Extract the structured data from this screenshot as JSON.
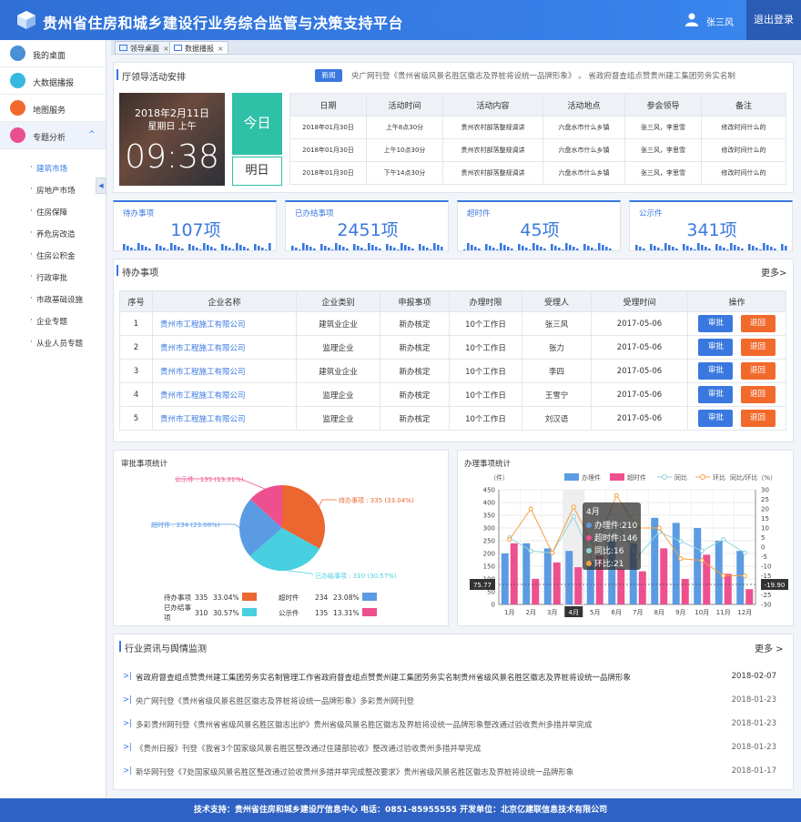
{
  "app": {
    "title": "贵州省住房和城乡建设行业务综合监管与决策支持平台",
    "user": "张三风",
    "logout": "退出登录"
  },
  "sidebar": {
    "items": [
      {
        "label": "我的桌面",
        "color": "#4a90d9"
      },
      {
        "label": "大数据播报",
        "color": "#36b8e0"
      },
      {
        "label": "地图服务",
        "color": "#f2692c"
      },
      {
        "label": "专题分析",
        "color": "#e84f8c"
      }
    ],
    "sub": [
      "建筑市场",
      "房地产市场",
      "住房保障",
      "养危房改造",
      "住房公积金",
      "行政审批",
      "市政基础设施",
      "企业专题",
      "从业人员专题"
    ],
    "arrow": "^",
    "dot": "·"
  },
  "tabs": [
    "领导桌面",
    "数据播报"
  ],
  "activities": {
    "title": "厅领导活动安排",
    "badge": "新闻",
    "marquee": "央广网刊登《贵州省级风景名胜区徽志及界桩将设统一品牌形象》  。  省政府督查组点赞贵州建工集团劳务实名制",
    "date": "2018年2月11日",
    "week": "星期日 上午",
    "time": "09:38",
    "today": "今日",
    "tomorrow": "明日",
    "headers": [
      "日期",
      "活动时间",
      "活动内容",
      "活动地点",
      "参会领导",
      "备注"
    ],
    "rows": [
      [
        "2018年01月30日",
        "上午8点30分",
        "贵州农村部落整规调讲",
        "六盘水市什么乡镇",
        "张三风，李思雪",
        "修改时间什么的"
      ],
      [
        "2018年01月30日",
        "上午10点30分",
        "贵州农村部落整规调讲",
        "六盘水市什么乡镇",
        "张三风，李思雪",
        "修改时间什么的"
      ],
      [
        "2018年01月30日",
        "下午14点30分",
        "贵州农村部落整规调讲",
        "六盘水市什么乡镇",
        "张三风，李思雪",
        "修改时间什么的"
      ]
    ]
  },
  "stats": [
    {
      "label": "待办事项",
      "value": "107项"
    },
    {
      "label": "已办结事项",
      "value": "2451项"
    },
    {
      "label": "超时件",
      "value": "45项"
    },
    {
      "label": "公示件",
      "value": "341项"
    }
  ],
  "todo": {
    "title": "待办事项",
    "more": "更多>",
    "headers": [
      "序号",
      "企业名称",
      "企业类别",
      "申报事项",
      "办理时限",
      "受理人",
      "受理时间",
      "操作"
    ],
    "rows": [
      [
        "1",
        "贵州市工程施工有限公司",
        "建筑业企业",
        "新办核定",
        "10个工作日",
        "张三风",
        "2017-05-06"
      ],
      [
        "2",
        "贵州市工程施工有限公司",
        "监理企业",
        "新办核定",
        "10个工作日",
        "张力",
        "2017-05-06"
      ],
      [
        "3",
        "贵州市工程施工有限公司",
        "建筑业企业",
        "新办核定",
        "10个工作日",
        "李四",
        "2017-05-06"
      ],
      [
        "4",
        "贵州市工程施工有限公司",
        "监理企业",
        "新办核定",
        "10个工作日",
        "王雪宁",
        "2017-05-06"
      ],
      [
        "5",
        "贵州市工程施工有限公司",
        "监理企业",
        "新办核定",
        "10个工作日",
        "刘汉语",
        "2017-05-06"
      ]
    ],
    "approve": "审批",
    "reject": "退回"
  },
  "pie": {
    "title": "审批事项统计",
    "labels": [
      "待办事项 : 335 (33.04%)",
      "已办结事项 : 310 (30.57%)",
      "超时件 : 234 (23.08%)",
      "公示件 : 135 (13.31%)"
    ],
    "legend": [
      [
        "待办事项",
        "335",
        "33.04%"
      ],
      [
        "已办结事项",
        "310",
        "30.57%"
      ],
      [
        "超时件",
        "234",
        "23.08%"
      ],
      [
        "公示件",
        "135",
        "13.31%"
      ]
    ]
  },
  "bars": {
    "title": "办理事项统计",
    "yl": "（件）",
    "yr": "同比/环比（%）",
    "legend": [
      "办理件",
      "超时件",
      "同比",
      "环比"
    ],
    "tooltip": {
      "title": "4月",
      "lines": [
        "办理件:210",
        "超时件:146",
        "同比:16",
        "环比:21"
      ]
    },
    "cursor": {
      "left": "75.77",
      "right": "-19.90",
      "x": "4月"
    }
  },
  "chart_data": [
    {
      "type": "pie",
      "title": "审批事项统计",
      "categories": [
        "待办事项",
        "已办结事项",
        "超时件",
        "公示件"
      ],
      "values": [
        335,
        310,
        234,
        135
      ],
      "colors": [
        "#ec6630",
        "#48cfe0",
        "#5b9be3",
        "#ee4f8f"
      ]
    },
    {
      "type": "bar",
      "title": "办理事项统计",
      "categories": [
        "1月",
        "2月",
        "3月",
        "4月",
        "5月",
        "6月",
        "7月",
        "8月",
        "9月",
        "10月",
        "11月",
        "12月"
      ],
      "ylim": [
        0,
        450
      ],
      "y2lim": [
        -30,
        30
      ],
      "series": [
        {
          "name": "办理件",
          "type": "bar",
          "values": [
            200,
            240,
            220,
            210,
            170,
            250,
            240,
            340,
            320,
            300,
            250,
            210
          ],
          "color": "#5b9be3"
        },
        {
          "name": "超时件",
          "type": "bar",
          "values": [
            240,
            100,
            165,
            146,
            190,
            140,
            130,
            220,
            100,
            195,
            120,
            60
          ],
          "color": "#ee4f8f"
        },
        {
          "name": "同比",
          "type": "line",
          "values": [
            5,
            -2,
            -3,
            16,
            -10,
            12,
            -5,
            8,
            3,
            -2,
            4,
            -3
          ],
          "color": "#8fd3dc"
        },
        {
          "name": "环比",
          "type": "line",
          "values": [
            4,
            20,
            -3,
            21,
            -1,
            27,
            10,
            10,
            -6,
            -7,
            -15,
            -15
          ],
          "color": "#f5a040"
        }
      ]
    }
  ],
  "news": {
    "title": "行业资讯与舆情监测",
    "more": "更多 >",
    "items": [
      [
        "省政府督查组点赞贵州建工集团劳务实名制管理工作省政府督查组点赞贵州建工集团劳务实名制贵州省级风景名胜区徽志及界桩将设统一品牌形象",
        "2018-02-07"
      ],
      [
        "央广网刊登《贵州省级风景名胜区徽志及界桩将设统一品牌形象》多彩贵州网刊登",
        "2018-01-23"
      ],
      [
        "多彩贵州网刊登《贵州省省级风景名胜区徽志出炉》贵州省级风景名胜区徽志及界桩将设统一品牌形象整改通过验收贵州多措并举完成",
        "2018-01-23"
      ],
      [
        "《贵州日报》刊登《我省3个国家级风景名胜区整改通过住建部验收》整改通过验收贵州多措并举完成",
        "2018-01-23"
      ],
      [
        "新华网刊登《7处国家级风景名胜区整改通过验收贵州多措并举完成整改要求》贵州省级风景名胜区徽志及界桩将设统一品牌形象",
        "2018-01-17"
      ]
    ]
  },
  "footer": "技术支持：贵州省住房和城乡建设厅信息中心  电话：0851-85955555  开发单位：北京亿建联信息技术有限公司"
}
